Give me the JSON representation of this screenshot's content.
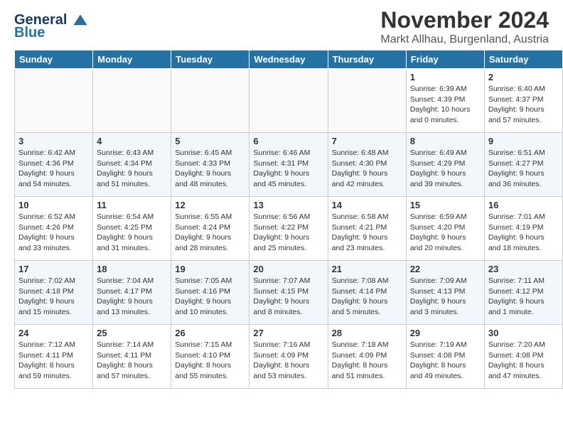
{
  "header": {
    "logo_line1": "General",
    "logo_line2": "Blue",
    "month_title": "November 2024",
    "location": "Markt Allhau, Burgenland, Austria"
  },
  "days_of_week": [
    "Sunday",
    "Monday",
    "Tuesday",
    "Wednesday",
    "Thursday",
    "Friday",
    "Saturday"
  ],
  "weeks": [
    [
      {
        "day": "",
        "info": ""
      },
      {
        "day": "",
        "info": ""
      },
      {
        "day": "",
        "info": ""
      },
      {
        "day": "",
        "info": ""
      },
      {
        "day": "",
        "info": ""
      },
      {
        "day": "1",
        "info": "Sunrise: 6:39 AM\nSunset: 4:39 PM\nDaylight: 10 hours\nand 0 minutes."
      },
      {
        "day": "2",
        "info": "Sunrise: 6:40 AM\nSunset: 4:37 PM\nDaylight: 9 hours\nand 57 minutes."
      }
    ],
    [
      {
        "day": "3",
        "info": "Sunrise: 6:42 AM\nSunset: 4:36 PM\nDaylight: 9 hours\nand 54 minutes."
      },
      {
        "day": "4",
        "info": "Sunrise: 6:43 AM\nSunset: 4:34 PM\nDaylight: 9 hours\nand 51 minutes."
      },
      {
        "day": "5",
        "info": "Sunrise: 6:45 AM\nSunset: 4:33 PM\nDaylight: 9 hours\nand 48 minutes."
      },
      {
        "day": "6",
        "info": "Sunrise: 6:46 AM\nSunset: 4:31 PM\nDaylight: 9 hours\nand 45 minutes."
      },
      {
        "day": "7",
        "info": "Sunrise: 6:48 AM\nSunset: 4:30 PM\nDaylight: 9 hours\nand 42 minutes."
      },
      {
        "day": "8",
        "info": "Sunrise: 6:49 AM\nSunset: 4:29 PM\nDaylight: 9 hours\nand 39 minutes."
      },
      {
        "day": "9",
        "info": "Sunrise: 6:51 AM\nSunset: 4:27 PM\nDaylight: 9 hours\nand 36 minutes."
      }
    ],
    [
      {
        "day": "10",
        "info": "Sunrise: 6:52 AM\nSunset: 4:26 PM\nDaylight: 9 hours\nand 33 minutes."
      },
      {
        "day": "11",
        "info": "Sunrise: 6:54 AM\nSunset: 4:25 PM\nDaylight: 9 hours\nand 31 minutes."
      },
      {
        "day": "12",
        "info": "Sunrise: 6:55 AM\nSunset: 4:24 PM\nDaylight: 9 hours\nand 28 minutes."
      },
      {
        "day": "13",
        "info": "Sunrise: 6:56 AM\nSunset: 4:22 PM\nDaylight: 9 hours\nand 25 minutes."
      },
      {
        "day": "14",
        "info": "Sunrise: 6:58 AM\nSunset: 4:21 PM\nDaylight: 9 hours\nand 23 minutes."
      },
      {
        "day": "15",
        "info": "Sunrise: 6:59 AM\nSunset: 4:20 PM\nDaylight: 9 hours\nand 20 minutes."
      },
      {
        "day": "16",
        "info": "Sunrise: 7:01 AM\nSunset: 4:19 PM\nDaylight: 9 hours\nand 18 minutes."
      }
    ],
    [
      {
        "day": "17",
        "info": "Sunrise: 7:02 AM\nSunset: 4:18 PM\nDaylight: 9 hours\nand 15 minutes."
      },
      {
        "day": "18",
        "info": "Sunrise: 7:04 AM\nSunset: 4:17 PM\nDaylight: 9 hours\nand 13 minutes."
      },
      {
        "day": "19",
        "info": "Sunrise: 7:05 AM\nSunset: 4:16 PM\nDaylight: 9 hours\nand 10 minutes."
      },
      {
        "day": "20",
        "info": "Sunrise: 7:07 AM\nSunset: 4:15 PM\nDaylight: 9 hours\nand 8 minutes."
      },
      {
        "day": "21",
        "info": "Sunrise: 7:08 AM\nSunset: 4:14 PM\nDaylight: 9 hours\nand 5 minutes."
      },
      {
        "day": "22",
        "info": "Sunrise: 7:09 AM\nSunset: 4:13 PM\nDaylight: 9 hours\nand 3 minutes."
      },
      {
        "day": "23",
        "info": "Sunrise: 7:11 AM\nSunset: 4:12 PM\nDaylight: 9 hours\nand 1 minute."
      }
    ],
    [
      {
        "day": "24",
        "info": "Sunrise: 7:12 AM\nSunset: 4:11 PM\nDaylight: 8 hours\nand 59 minutes."
      },
      {
        "day": "25",
        "info": "Sunrise: 7:14 AM\nSunset: 4:11 PM\nDaylight: 8 hours\nand 57 minutes."
      },
      {
        "day": "26",
        "info": "Sunrise: 7:15 AM\nSunset: 4:10 PM\nDaylight: 8 hours\nand 55 minutes."
      },
      {
        "day": "27",
        "info": "Sunrise: 7:16 AM\nSunset: 4:09 PM\nDaylight: 8 hours\nand 53 minutes."
      },
      {
        "day": "28",
        "info": "Sunrise: 7:18 AM\nSunset: 4:09 PM\nDaylight: 8 hours\nand 51 minutes."
      },
      {
        "day": "29",
        "info": "Sunrise: 7:19 AM\nSunset: 4:08 PM\nDaylight: 8 hours\nand 49 minutes."
      },
      {
        "day": "30",
        "info": "Sunrise: 7:20 AM\nSunset: 4:08 PM\nDaylight: 8 hours\nand 47 minutes."
      }
    ]
  ]
}
